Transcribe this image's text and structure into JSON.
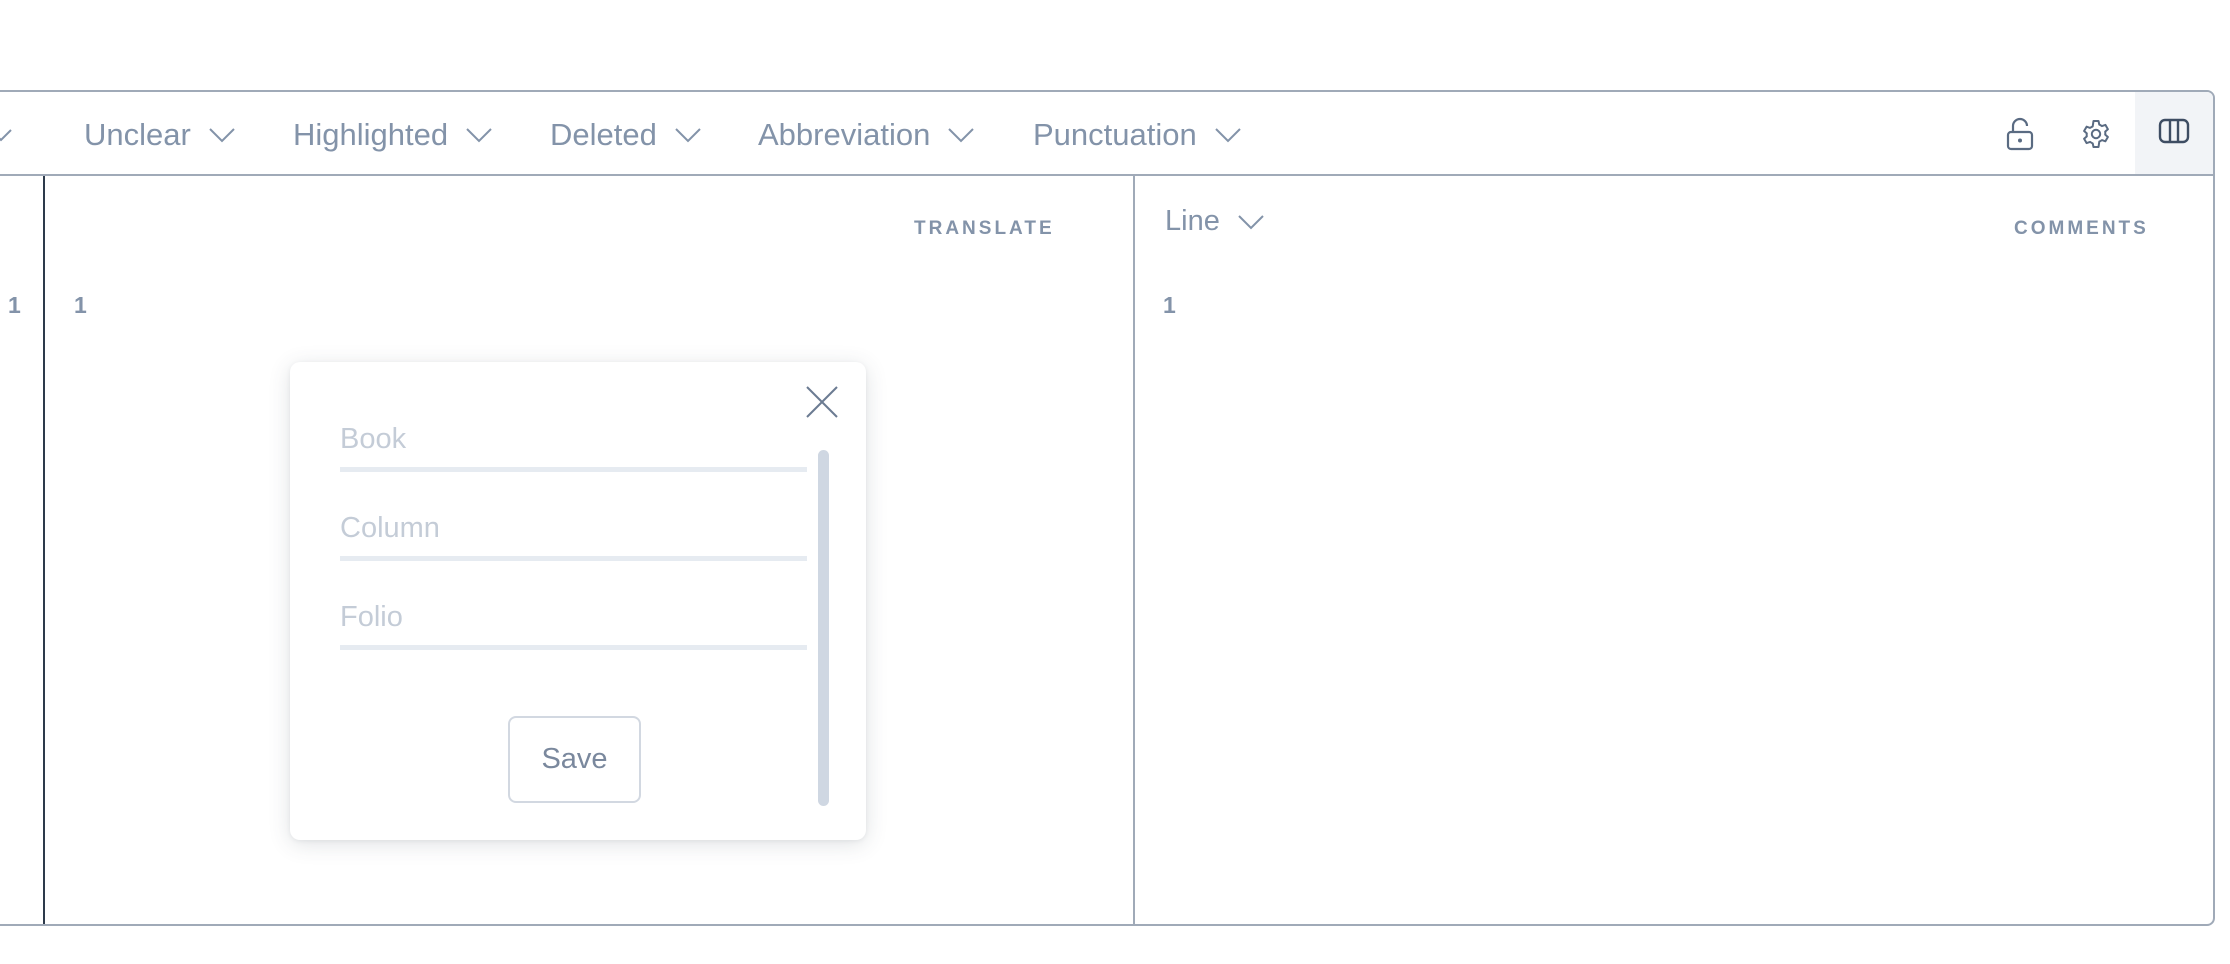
{
  "toolbar": {
    "filters": [
      {
        "label": "Unclear"
      },
      {
        "label": "Highlighted"
      },
      {
        "label": "Deleted"
      },
      {
        "label": "Abbreviation"
      },
      {
        "label": "Punctuation"
      }
    ],
    "icons": [
      "unlock-icon",
      "gear-icon",
      "columns-icon"
    ]
  },
  "left_strip": {
    "line_number": "1"
  },
  "translate_pane": {
    "label": "TRANSLATE",
    "line_number": "1"
  },
  "comments_pane": {
    "label": "COMMENTS",
    "line_select": "Line",
    "line_number": "1"
  },
  "popover": {
    "book_placeholder": "Book",
    "column_placeholder": "Column",
    "folio_placeholder": "Folio",
    "book_value": "",
    "column_value": "",
    "folio_value": "",
    "save_label": "Save"
  },
  "colors": {
    "text_muted": "#8393a9",
    "border": "#a0aab8",
    "placeholder": "#c4ccd7"
  }
}
